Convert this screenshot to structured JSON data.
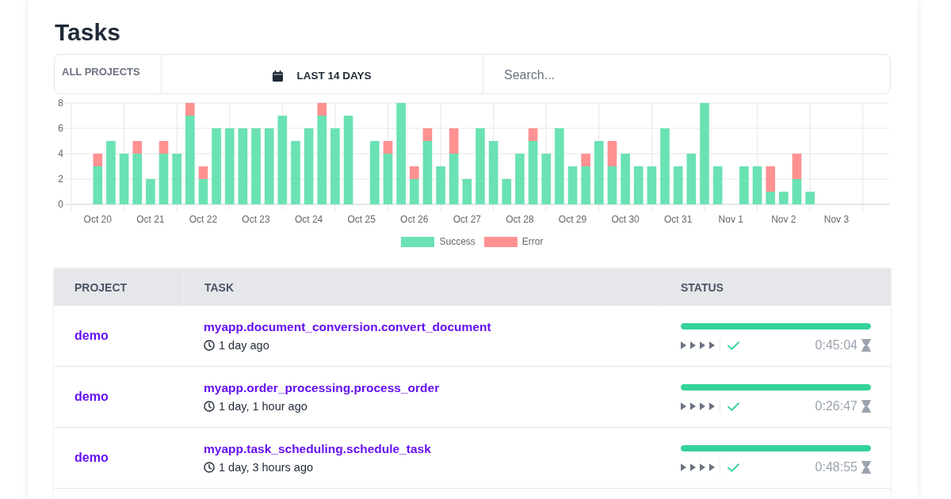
{
  "page": {
    "title": "Tasks"
  },
  "filters": {
    "project": "ALL PROJECTS",
    "range": "LAST 14 DAYS",
    "search": {
      "placeholder": "Search..."
    }
  },
  "chart": {
    "chart_data": {
      "type": "bar",
      "stacked": true,
      "grid": true,
      "categories": [
        "Oct 20",
        null,
        null,
        null,
        "Oct 21",
        null,
        null,
        null,
        "Oct 22",
        null,
        null,
        null,
        "Oct 23",
        null,
        null,
        null,
        "Oct 24",
        null,
        null,
        null,
        "Oct 25",
        null,
        null,
        null,
        "Oct 26",
        null,
        null,
        null,
        "Oct 27",
        null,
        null,
        null,
        "Oct 28",
        null,
        null,
        null,
        "Oct 29",
        null,
        null,
        null,
        "Oct 30",
        null,
        null,
        null,
        "Oct 31",
        null,
        null,
        null,
        "Nov 1",
        null,
        null,
        null,
        "Nov 2",
        null,
        null,
        null,
        "Nov 3",
        null,
        null,
        null
      ],
      "series": [
        {
          "name": "Success",
          "color": "#6ae2b3",
          "values": [
            3,
            5,
            4,
            4,
            2,
            4,
            4,
            7,
            2,
            6,
            6,
            6,
            6,
            6,
            7,
            5,
            6,
            7,
            6,
            7,
            0,
            5,
            4,
            8,
            2,
            5,
            3,
            4,
            2,
            6,
            5,
            2,
            4,
            5,
            4,
            6,
            3,
            3,
            5,
            3,
            4,
            3,
            3,
            6,
            3,
            4,
            8,
            3,
            0,
            3,
            3,
            1,
            1,
            2,
            1,
            0,
            0,
            0,
            0,
            0
          ]
        },
        {
          "name": "Error",
          "color": "#ff9191",
          "values": [
            1,
            0,
            0,
            1,
            0,
            1,
            0,
            1,
            1,
            0,
            0,
            0,
            0,
            0,
            0,
            0,
            0,
            1,
            0,
            0,
            0,
            0,
            1,
            0,
            1,
            1,
            0,
            2,
            0,
            0,
            0,
            0,
            0,
            1,
            0,
            0,
            0,
            1,
            0,
            2,
            0,
            0,
            0,
            0,
            0,
            0,
            0,
            0,
            0,
            0,
            0,
            2,
            0,
            2,
            0,
            0,
            0,
            0,
            0,
            0
          ]
        }
      ],
      "ylim": [
        0,
        8
      ],
      "yticks": [
        0,
        2,
        4,
        6,
        8
      ]
    }
  },
  "table": {
    "columns": [
      "PROJECT",
      "TASK",
      "STATUS"
    ],
    "rows": [
      {
        "project": "demo",
        "task": "myapp.document_conversion.convert_document",
        "age": "1 day ago",
        "progress": {
          "level": 1
        },
        "succeeded": true,
        "duration": "0:45:04"
      },
      {
        "project": "demo",
        "task": "myapp.order_processing.process_order",
        "age": "1 day, 1 hour ago",
        "progress": {
          "level": 1
        },
        "succeeded": true,
        "duration": "0:26:47"
      },
      {
        "project": "demo",
        "task": "myapp.task_scheduling.schedule_task",
        "age": "1 day, 3 hours ago",
        "progress": {
          "level": 1
        },
        "succeeded": true,
        "duration": "0:48:55"
      }
    ]
  }
}
